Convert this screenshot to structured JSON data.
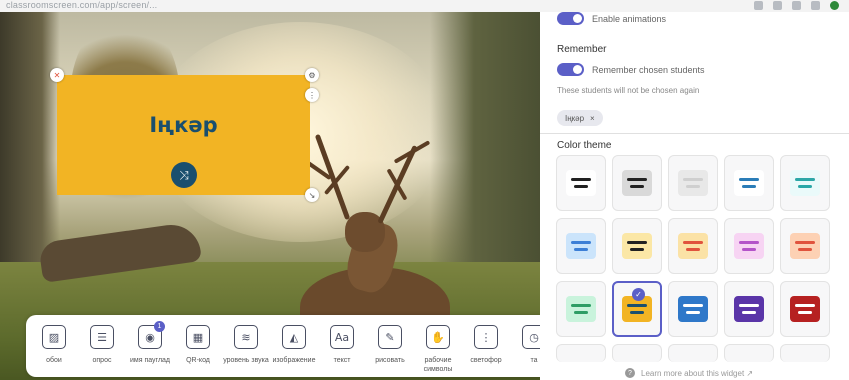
{
  "browser": {
    "url": "classroomscreen.com/app/screen/..."
  },
  "widget": {
    "name": "Іңкәр",
    "shuffle_icon": "shuffle-icon",
    "close_icon": "close-icon",
    "settings_icon": "gear-icon",
    "more_icon": "more-icon",
    "resize_icon": "resize-icon"
  },
  "panel": {
    "animations_label": "Enable animations",
    "remember_title": "Remember",
    "remember_label": "Remember chosen students",
    "remember_note": "These students will not be chosen again",
    "chip_label": "Іңкәр",
    "chip_close": "×",
    "color_theme_title": "Color theme",
    "footer_text": "Learn more about this widget ↗",
    "footer_icon": "help-icon",
    "selected_theme_index": 11,
    "themes": [
      {
        "bg": "#ffffff",
        "line": "#222222",
        "dot": "#5b5fc7"
      },
      {
        "bg": "#d9d9d9",
        "line": "#222222",
        "dot": "#222222"
      },
      {
        "bg": "#e8e8e8",
        "line": "#cfcfcf",
        "dot": "#cfcfcf"
      },
      {
        "bg": "#ffffff",
        "line": "#2b7db8",
        "dot": "#2b7db8"
      },
      {
        "bg": "#eafafa",
        "line": "#2aa7a7",
        "dot": "#2aa7a7"
      },
      {
        "bg": "#cbe4fb",
        "line": "#3d7fd6",
        "dot": "#3d7fd6"
      },
      {
        "bg": "#fbe7a6",
        "line": "#222222",
        "dot": "#2d9a4e"
      },
      {
        "bg": "#fbe2a6",
        "line": "#e0533d",
        "dot": "#e0533d"
      },
      {
        "bg": "#f7d4f3",
        "line": "#b453c9",
        "dot": "#b453c9"
      },
      {
        "bg": "#fdd1b4",
        "line": "#e0533d",
        "dot": "#e0533d"
      },
      {
        "bg": "#c9f3dc",
        "line": "#2e9d65",
        "dot": "#2e9d65"
      },
      {
        "bg": "#f2b424",
        "line": "#1a4f6e",
        "dot": "#1a4f6e"
      },
      {
        "bg": "#2f78c9",
        "line": "#ffffff",
        "dot": "#ffffff"
      },
      {
        "bg": "#5a35a8",
        "line": "#ffffff",
        "dot": "#ffffff"
      },
      {
        "bg": "#b62121",
        "line": "#ffffff",
        "dot": "#ffffff"
      }
    ]
  },
  "toolbar": {
    "items": [
      {
        "label": "обои",
        "icon": "wallpaper-icon",
        "glyph": "▨"
      },
      {
        "label": "опрос",
        "icon": "poll-icon",
        "glyph": "☰"
      },
      {
        "label": "имя пауглад",
        "icon": "random-name-icon",
        "glyph": "◉",
        "badge": "1"
      },
      {
        "label": "QR-код",
        "icon": "qr-code-icon",
        "glyph": "▦"
      },
      {
        "label": "уровень звука",
        "icon": "sound-level-icon",
        "glyph": "≋"
      },
      {
        "label": "изображение",
        "icon": "image-icon",
        "glyph": "◭"
      },
      {
        "label": "текст",
        "icon": "text-icon",
        "glyph": "Aa"
      },
      {
        "label": "рисовать",
        "icon": "draw-icon",
        "glyph": "✎"
      },
      {
        "label": "рабочие символы",
        "icon": "work-symbols-icon",
        "glyph": "✋"
      },
      {
        "label": "светофор",
        "icon": "traffic-light-icon",
        "glyph": "⋮"
      },
      {
        "label": "та",
        "icon": "timer-icon",
        "glyph": "◷"
      }
    ]
  }
}
